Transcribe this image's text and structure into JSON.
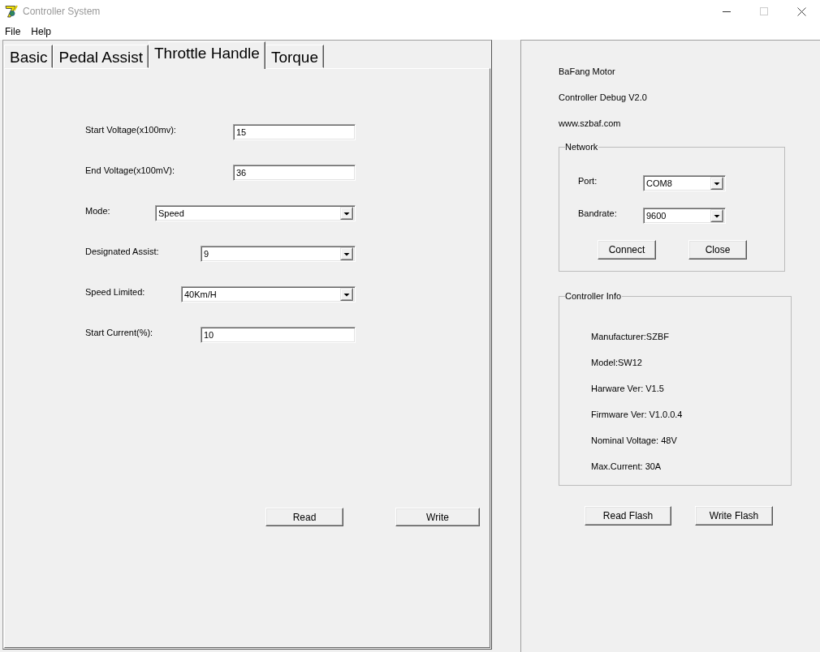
{
  "window": {
    "title": "Controller System",
    "maximize_disabled": true
  },
  "menu": [
    {
      "label": "File"
    },
    {
      "label": "Help"
    }
  ],
  "tabs": [
    {
      "label": "Basic",
      "selected": false
    },
    {
      "label": "Pedal Assist",
      "selected": false
    },
    {
      "label": "Throttle Handle",
      "selected": true
    },
    {
      "label": "Torque",
      "selected": false
    }
  ],
  "throttle_form": {
    "fields": [
      {
        "label": "Start Voltage(x100mv):",
        "kind": "text",
        "value": "15"
      },
      {
        "label": "End Voltage(x100mV):",
        "kind": "text",
        "value": "36"
      },
      {
        "label": "Mode:",
        "kind": "dropdown",
        "value": "Speed"
      },
      {
        "label": "Designated Assist:",
        "kind": "dropdown",
        "value": "9"
      },
      {
        "label": "Speed Limited:",
        "kind": "dropdown",
        "value": "40Km/H"
      },
      {
        "label": "Start Current(%):",
        "kind": "text",
        "value": "10"
      }
    ],
    "buttons": [
      "Read",
      "Write"
    ]
  },
  "about": [
    "BaFang Motor",
    "Controller Debug V2.0",
    "www.szbaf.com"
  ],
  "network": {
    "title": "Network",
    "fields": [
      {
        "label": "Port:",
        "value": "COM8"
      },
      {
        "label": "Bandrate:",
        "value": "9600"
      }
    ],
    "buttons": [
      "Connect",
      "Close"
    ]
  },
  "controller_info": {
    "title": "Controller Info",
    "lines": [
      "Manufacturer:SZBF",
      "Model:SW12",
      "Harware Ver: V1.5",
      "Firmware Ver: V1.0.0.4",
      "Nominal Voltage: 48V",
      "Max.Current: 30A"
    ]
  },
  "flash_buttons": [
    "Read Flash",
    "Write Flash"
  ]
}
